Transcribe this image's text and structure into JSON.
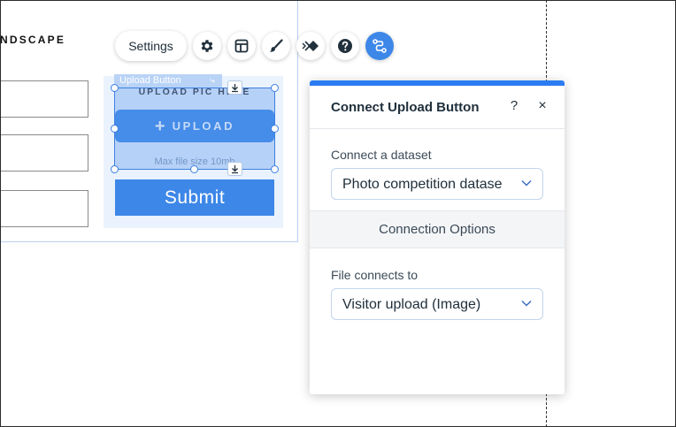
{
  "canvas": {
    "form_title": "NDSCAPE",
    "upload_element": {
      "selection_label": "Upload Button",
      "heading": "UPLOAD PIC HERE",
      "button_label": "UPLOAD",
      "button_icon": "plus-icon",
      "max_size_text": "Max file size 10mb"
    },
    "submit_label": "Submit"
  },
  "toolbar": {
    "settings_label": "Settings",
    "tools": [
      {
        "name": "settings-gear-icon",
        "active": false
      },
      {
        "name": "layout-icon",
        "active": false
      },
      {
        "name": "design-brush-icon",
        "active": false
      },
      {
        "name": "animation-icon",
        "active": false
      },
      {
        "name": "help-icon",
        "active": false
      },
      {
        "name": "connect-data-icon",
        "active": true
      }
    ]
  },
  "panel": {
    "title": "Connect Upload Button",
    "help_label": "?",
    "close_label": "×",
    "dataset_label": "Connect a dataset",
    "dataset_value": "Photo competition dataset",
    "section_title": "Connection Options",
    "file_label": "File connects to",
    "file_value": "Visitor upload (Image)"
  },
  "colors": {
    "accent": "#2b7cf1",
    "button_blue": "#3d87e8",
    "selection_blue": "#3d7fe0",
    "text_dark": "#20303c"
  }
}
